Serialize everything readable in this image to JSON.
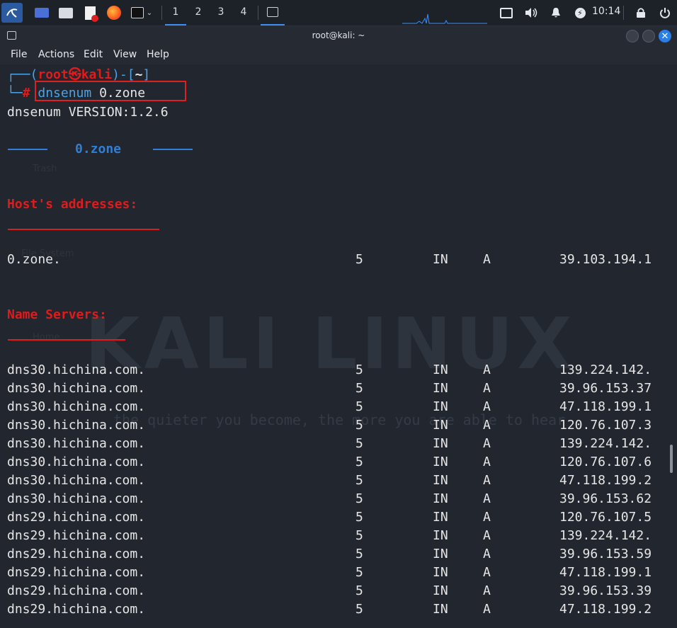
{
  "panel": {
    "workspaces": [
      "1",
      "2",
      "3",
      "4"
    ],
    "clock": "10:14"
  },
  "window": {
    "title": "root@kali: ~",
    "close_glyph": "✕"
  },
  "menu": [
    "File",
    "Actions",
    "Edit",
    "View",
    "Help"
  ],
  "prompt": {
    "open": "┌──(",
    "user_host": "root㉿kali",
    "mid": ")-[",
    "cwd": "~",
    "close": "]",
    "corner": "└─",
    "hash": "#",
    "command": "dnsenum",
    "argument": "0.zone"
  },
  "output": {
    "version": "dnsenum VERSION:1.2.6",
    "domain_header": "0.zone",
    "hosts_header": "Host's addresses:",
    "name_servers_header": "Name Servers:"
  },
  "host_records": [
    {
      "name": "0.zone.",
      "ttl": "5",
      "class": "IN",
      "type": "A",
      "address": "39.103.194.1"
    }
  ],
  "ns_records": [
    {
      "name": "dns30.hichina.com.",
      "ttl": "5",
      "class": "IN",
      "type": "A",
      "address": "139.224.142."
    },
    {
      "name": "dns30.hichina.com.",
      "ttl": "5",
      "class": "IN",
      "type": "A",
      "address": "39.96.153.37"
    },
    {
      "name": "dns30.hichina.com.",
      "ttl": "5",
      "class": "IN",
      "type": "A",
      "address": "47.118.199.1"
    },
    {
      "name": "dns30.hichina.com.",
      "ttl": "5",
      "class": "IN",
      "type": "A",
      "address": "120.76.107.3"
    },
    {
      "name": "dns30.hichina.com.",
      "ttl": "5",
      "class": "IN",
      "type": "A",
      "address": "139.224.142."
    },
    {
      "name": "dns30.hichina.com.",
      "ttl": "5",
      "class": "IN",
      "type": "A",
      "address": "120.76.107.6"
    },
    {
      "name": "dns30.hichina.com.",
      "ttl": "5",
      "class": "IN",
      "type": "A",
      "address": "47.118.199.2"
    },
    {
      "name": "dns30.hichina.com.",
      "ttl": "5",
      "class": "IN",
      "type": "A",
      "address": "39.96.153.62"
    },
    {
      "name": "dns29.hichina.com.",
      "ttl": "5",
      "class": "IN",
      "type": "A",
      "address": "120.76.107.5"
    },
    {
      "name": "dns29.hichina.com.",
      "ttl": "5",
      "class": "IN",
      "type": "A",
      "address": "139.224.142."
    },
    {
      "name": "dns29.hichina.com.",
      "ttl": "5",
      "class": "IN",
      "type": "A",
      "address": "39.96.153.59"
    },
    {
      "name": "dns29.hichina.com.",
      "ttl": "5",
      "class": "IN",
      "type": "A",
      "address": "47.118.199.1"
    },
    {
      "name": "dns29.hichina.com.",
      "ttl": "5",
      "class": "IN",
      "type": "A",
      "address": "39.96.153.39"
    },
    {
      "name": "dns29.hichina.com.",
      "ttl": "5",
      "class": "IN",
      "type": "A",
      "address": "47.118.199.2"
    }
  ],
  "background": {
    "watermark": "KALI LINUX",
    "tagline": "the quieter you become, the more you are able to hear",
    "desktop_labels": [
      "Trash",
      "File System",
      "Home"
    ]
  },
  "colors": {
    "accent": "#2f7ed8",
    "prompt_red": "#e01b1b",
    "terminal_bg": "#22262e",
    "highlight_box": "#e02020"
  }
}
